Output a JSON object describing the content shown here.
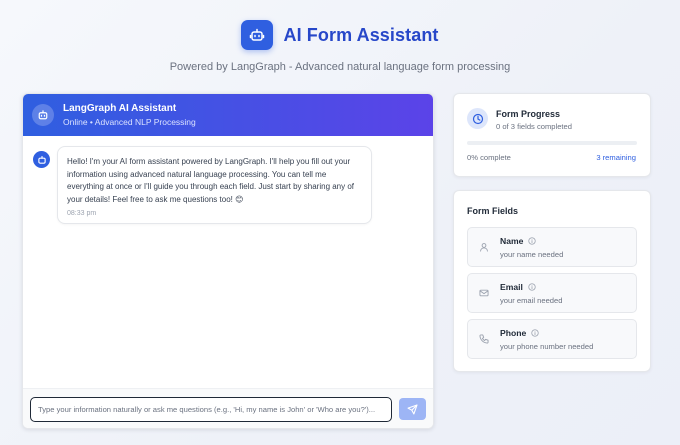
{
  "header": {
    "title": "AI Form Assistant",
    "subtitle": "Powered by LangGraph - Advanced natural language form processing",
    "logo_icon": "robot-icon",
    "accent_color": "#2f5fe0"
  },
  "chat": {
    "title": "LangGraph AI Assistant",
    "status": "Online • Advanced NLP Processing",
    "messages": [
      {
        "sender": "assistant",
        "text": "Hello! I'm your AI form assistant powered by LangGraph. I'll help you fill out your information using advanced natural language processing. You can tell me everything at once or I'll guide you through each field. Just start by sharing any of your details! Feel free to ask me questions too! 😊",
        "time": "08:33 pm"
      }
    ],
    "input": {
      "value": "",
      "placeholder": "Type your information naturally or ask me questions (e.g., 'Hi, my name is John' or 'Who are you?')..."
    },
    "send_icon": "send-icon"
  },
  "progress": {
    "title": "Form Progress",
    "subtitle": "0 of 3 fields completed",
    "percent_label": "0% complete",
    "remaining_label": "3 remaining",
    "fraction": 0,
    "icon": "clock-icon"
  },
  "form_fields": {
    "title": "Form Fields",
    "fields": [
      {
        "label": "Name",
        "hint": "your name needed",
        "icon": "user-icon"
      },
      {
        "label": "Email",
        "hint": "your email needed",
        "icon": "mail-icon"
      },
      {
        "label": "Phone",
        "hint": "your phone number needed",
        "icon": "phone-icon"
      }
    ]
  }
}
